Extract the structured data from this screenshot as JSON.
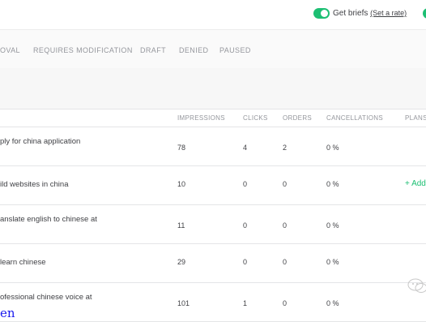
{
  "header": {
    "get_briefs_label": "Get briefs",
    "set_rate_link": "(Set a rate)"
  },
  "tabs": [
    {
      "label": "OVAL"
    },
    {
      "label": "REQUIRES MODIFICATION"
    },
    {
      "label": "DRAFT"
    },
    {
      "label": "DENIED"
    },
    {
      "label": "PAUSED"
    }
  ],
  "table": {
    "columns": [
      "IMPRESSIONS",
      "CLICKS",
      "ORDERS",
      "CANCELLATIONS",
      "PLANS"
    ],
    "rows": [
      {
        "title": "ply for china application",
        "impressions": "78",
        "clicks": "4",
        "orders": "2",
        "cancellations": "0 %",
        "plans": ""
      },
      {
        "title": "ild websites in china",
        "impressions": "10",
        "clicks": "0",
        "orders": "0",
        "cancellations": "0 %",
        "plans": "+ Add"
      },
      {
        "title": "anslate english to chinese at",
        "impressions": "11",
        "clicks": "0",
        "orders": "0",
        "cancellations": "0 %",
        "plans": ""
      },
      {
        "title": "learn chinese",
        "impressions": "29",
        "clicks": "0",
        "orders": "0",
        "cancellations": "0 %",
        "plans": ""
      },
      {
        "title": "ofessional chinese voice at",
        "impressions": "101",
        "clicks": "1",
        "orders": "0",
        "cancellations": "0 %",
        "plans": ""
      }
    ]
  },
  "overlay": {
    "text": "en"
  },
  "colors": {
    "accent": "#1dbf73",
    "muted": "#95979d",
    "text": "#404145"
  }
}
